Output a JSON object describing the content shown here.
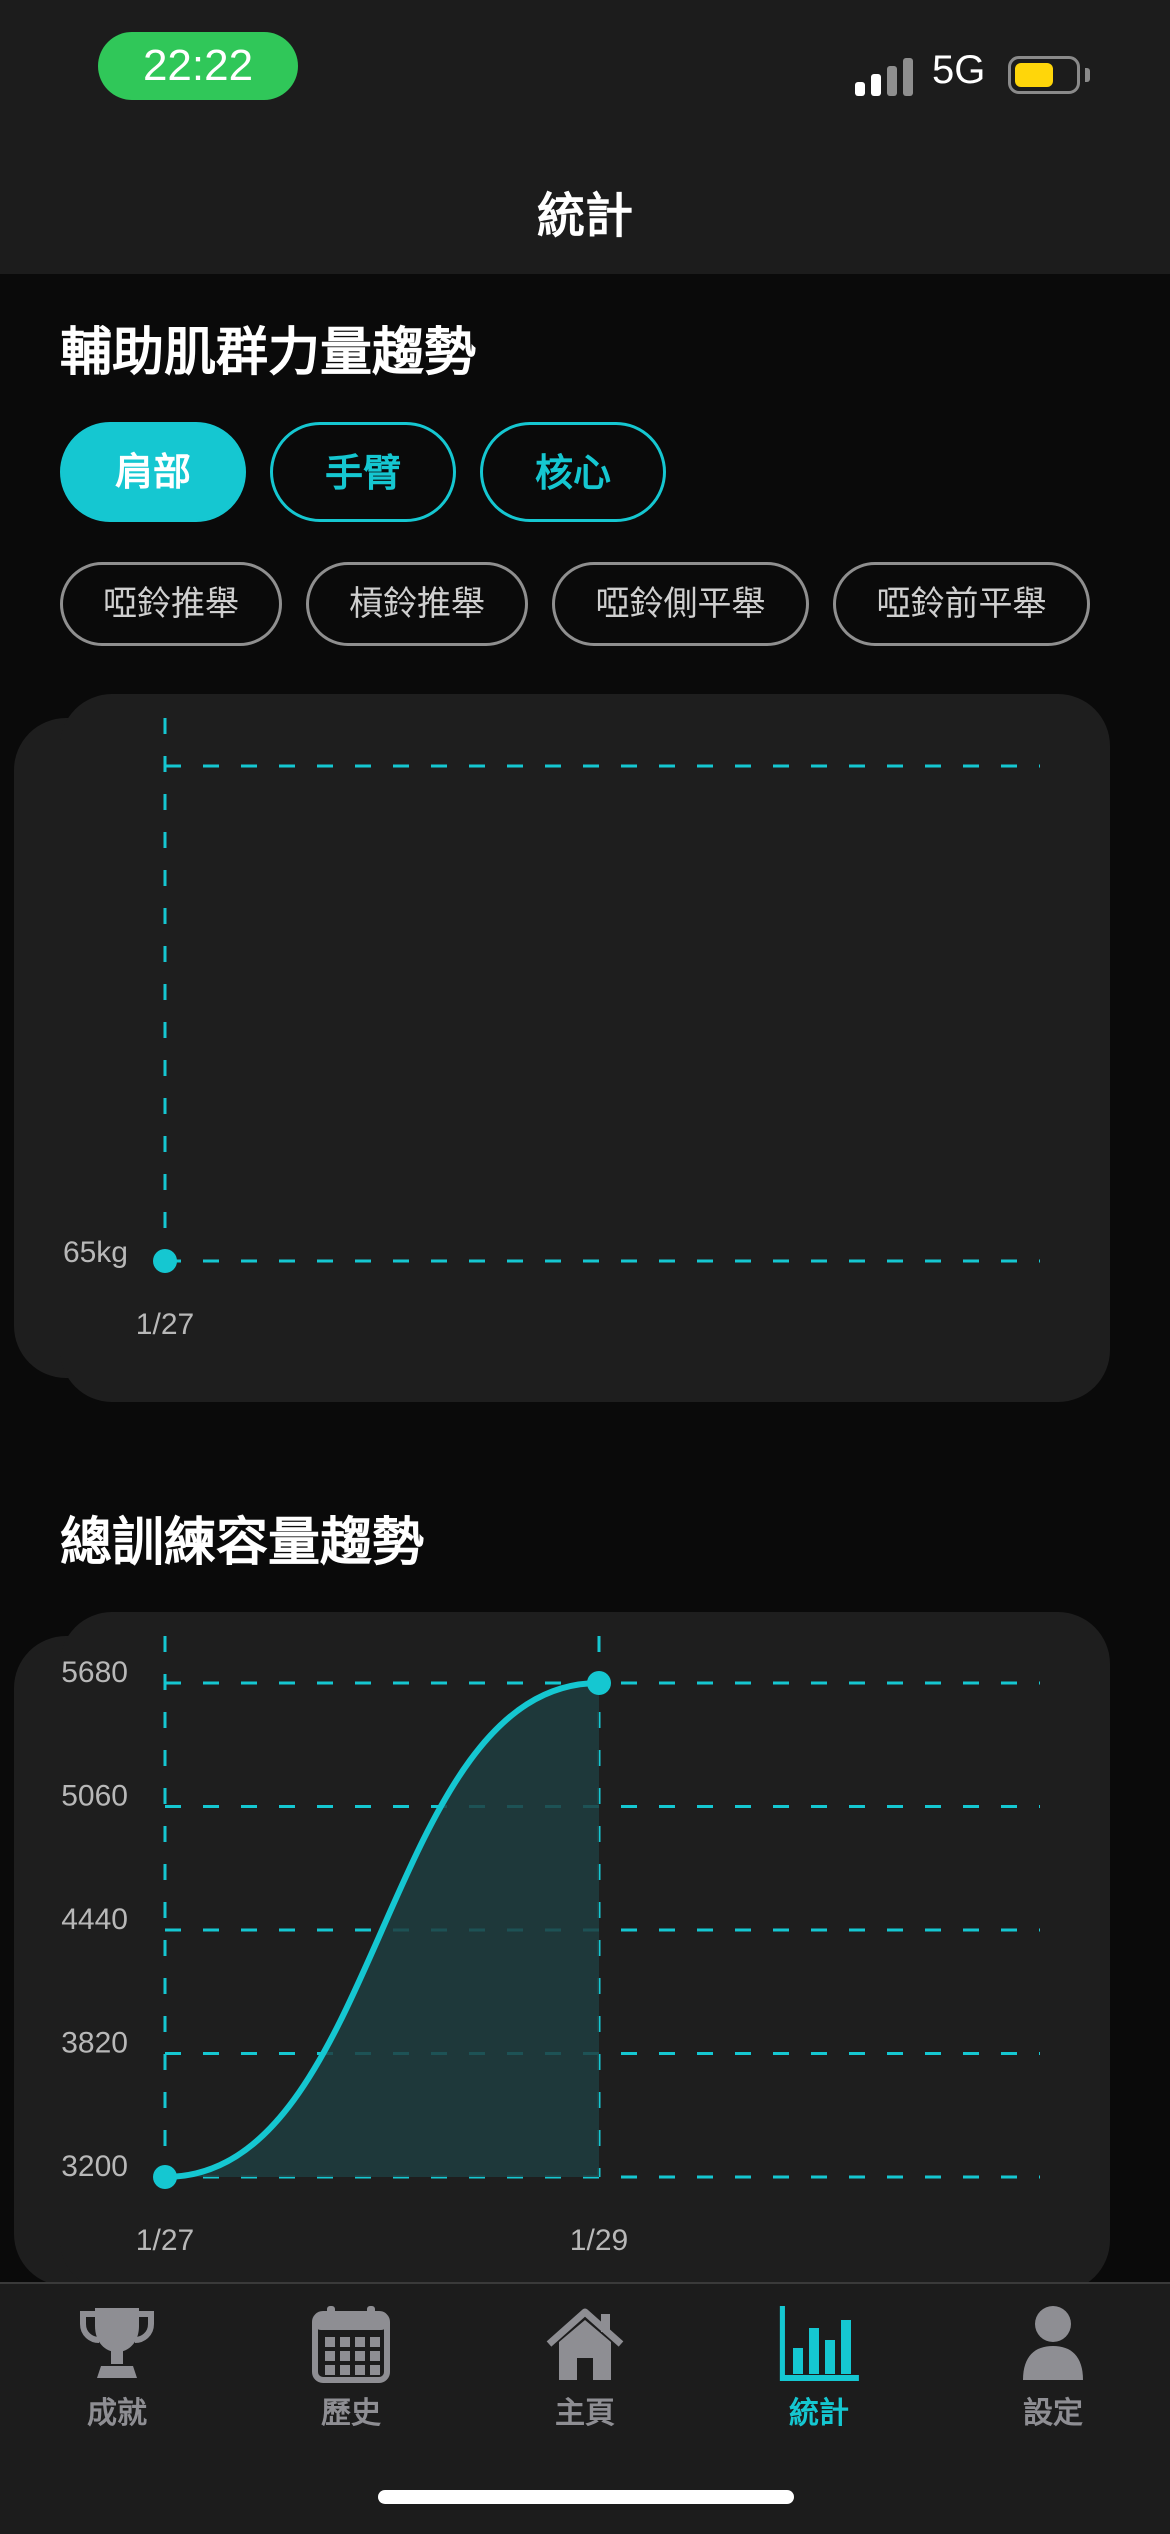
{
  "status_bar": {
    "time": "22:22",
    "network": "5G",
    "battery_level": 0.6,
    "battery_color": "#ffd60a"
  },
  "nav": {
    "title": "統計"
  },
  "strength_section": {
    "title": "輔助肌群力量趨勢",
    "categories": [
      {
        "label": "肩部",
        "selected": true
      },
      {
        "label": "手臂",
        "selected": false
      },
      {
        "label": "核心",
        "selected": false
      }
    ],
    "exercises": [
      "啞鈴推舉",
      "槓鈴推舉",
      "啞鈴側平舉",
      "啞鈴前平舉"
    ]
  },
  "volume_section": {
    "title": "總訓練容量趨勢"
  },
  "chart_data": [
    {
      "type": "line",
      "title": "輔助肌群力量趨勢",
      "x": [
        "1/27"
      ],
      "y_tick_labels": [
        "65kg"
      ],
      "series": [
        {
          "values": [
            65
          ]
        }
      ],
      "grid": true,
      "color": "#15c7d1"
    },
    {
      "type": "area",
      "title": "總訓練容量趨勢",
      "x": [
        "1/27",
        "1/29"
      ],
      "y_ticks": [
        3200,
        3820,
        4440,
        5060,
        5680
      ],
      "y_tick_labels": [
        "3200",
        "3820",
        "4440",
        "5060",
        "5680"
      ],
      "ylim": [
        3200,
        5680
      ],
      "series": [
        {
          "values": [
            3200,
            5680
          ]
        }
      ],
      "grid": true,
      "color": "#15c7d1"
    }
  ],
  "tabbar": {
    "items": [
      {
        "label": "成就",
        "icon": "trophy-icon",
        "active": false
      },
      {
        "label": "歷史",
        "icon": "calendar-icon",
        "active": false
      },
      {
        "label": "主頁",
        "icon": "home-icon",
        "active": false
      },
      {
        "label": "統計",
        "icon": "bar-chart-icon",
        "active": true
      },
      {
        "label": "設定",
        "icon": "person-icon",
        "active": false
      }
    ],
    "active_color": "#15c7d1",
    "inactive_color": "#8e8e93"
  }
}
